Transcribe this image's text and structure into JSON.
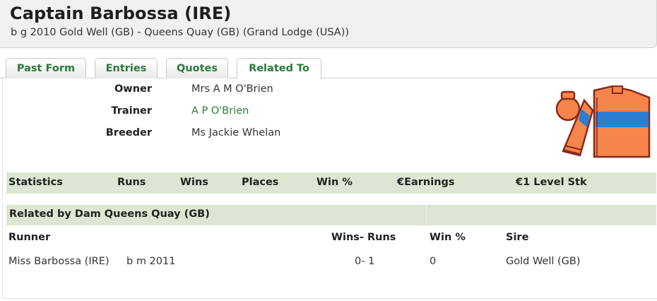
{
  "horse": {
    "name": "Captain Barbossa (IRE)",
    "pedigree": "b g 2010 Gold Well (GB) - Queens Quay (GB) (Grand Lodge (USA))"
  },
  "tabs": [
    {
      "label": "Past Form"
    },
    {
      "label": "Entries"
    },
    {
      "label": "Quotes"
    },
    {
      "label": "Related To"
    }
  ],
  "info": {
    "owner_label": "Owner",
    "owner_value": "Mrs A M O'Brien",
    "trainer_label": "Trainer",
    "trainer_value": "A P O'Brien",
    "breeder_label": "Breeder",
    "breeder_value": "Ms Jackie Whelan"
  },
  "silks": {
    "icon": "jockey-silks-icon",
    "body_color": "#f5854a",
    "band_color": "#2a7fd4",
    "outline_color": "#8a2a1a"
  },
  "stats": {
    "headers": [
      "Statistics",
      "Runs",
      "Wins",
      "Places",
      "Win %",
      "€Earnings",
      "€1 Level Stk"
    ]
  },
  "related": {
    "title": "Related by Dam Queens Quay (GB)",
    "columns": [
      "Runner",
      "Wins- Runs",
      "Win %",
      "Sire"
    ],
    "rows": [
      {
        "runner": "Miss Barbossa (IRE)",
        "details": "b m 2011",
        "wins_runs": "0- 1",
        "win_pct": "0",
        "sire": "Gold Well (GB)"
      }
    ]
  },
  "colors": {
    "link": "#2a7a3a",
    "bar_bg": "#dce6d2",
    "header_bg": "#f0f0f0"
  }
}
